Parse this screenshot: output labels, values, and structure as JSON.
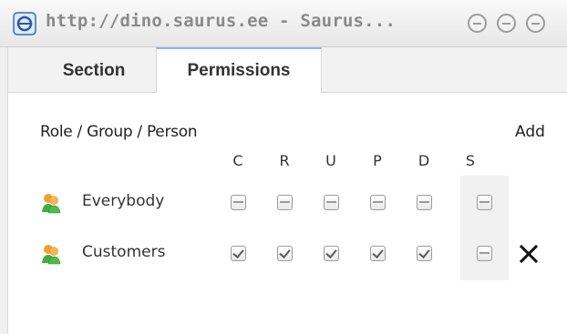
{
  "window": {
    "title": "http://dino.saurus.ee - Saurus...",
    "buttons": [
      "minimize-button",
      "maximize-button",
      "close-button"
    ]
  },
  "tabs": [
    {
      "label": "Section",
      "active": false
    },
    {
      "label": "Permissions",
      "active": true
    }
  ],
  "permissions": {
    "header_label": "Role / Group / Person",
    "add_label": "Add",
    "columns": [
      "C",
      "R",
      "U",
      "P",
      "D",
      "S"
    ],
    "rows": [
      {
        "name": "Everybody",
        "icon": "user-group-icon",
        "values": [
          false,
          false,
          false,
          false,
          false,
          false
        ],
        "removable": false
      },
      {
        "name": "Customers",
        "icon": "user-group-icon",
        "values": [
          true,
          true,
          true,
          true,
          true,
          false
        ],
        "removable": true
      }
    ]
  },
  "colors": {
    "tab_accent": "#8fb5e0",
    "title_text": "#8a8a8a",
    "remove_x": "#111111"
  }
}
